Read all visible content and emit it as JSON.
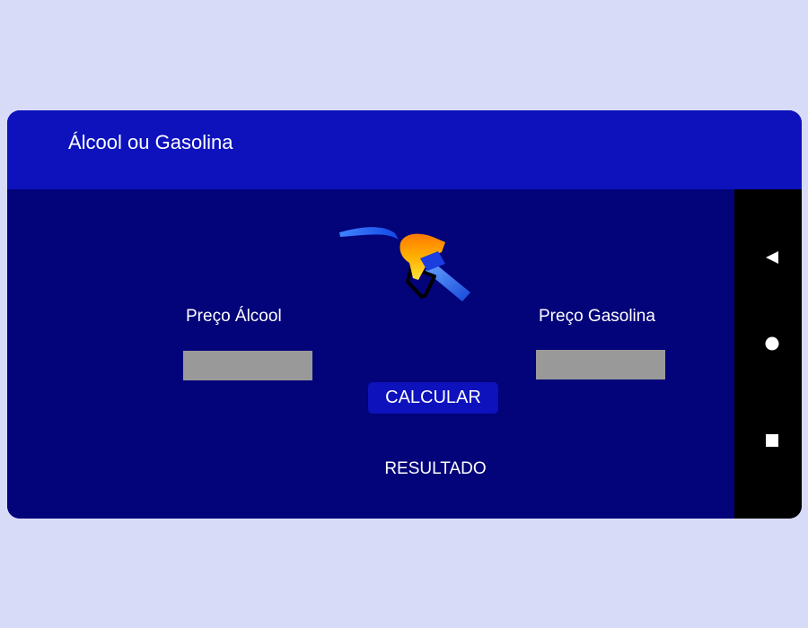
{
  "app": {
    "title": "Álcool ou Gasolina"
  },
  "form": {
    "alcohol_label": "Preço  Álcool",
    "gasoline_label": "Preço Gasolina",
    "alcohol_value": "",
    "gasoline_value": "",
    "calculate_label": "CALCULAR",
    "result_text": "RESULTADO"
  },
  "nav": {
    "icons": [
      "back-icon",
      "home-icon",
      "recents-icon"
    ]
  },
  "colors": {
    "background": "#d8dbf7",
    "app_bar": "#0d12bc",
    "content": "#03037a",
    "input": "#999999",
    "nav_bar": "#000000",
    "text": "#ffffff"
  }
}
